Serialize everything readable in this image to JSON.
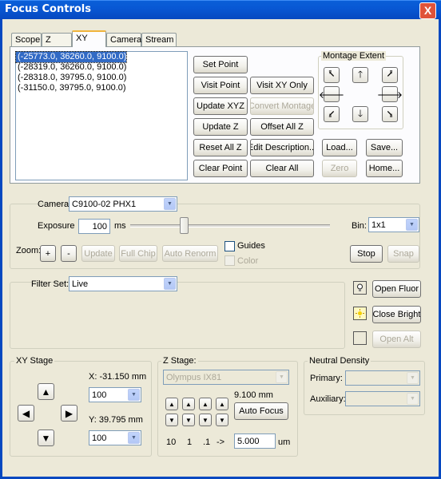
{
  "window": {
    "title": "Focus Controls",
    "close_glyph": "X"
  },
  "tabs": [
    {
      "label": "Scope",
      "active": false
    },
    {
      "label": "Z",
      "active": false
    },
    {
      "label": "XY",
      "active": true
    },
    {
      "label": "Camera",
      "active": false
    },
    {
      "label": "Stream",
      "active": false
    }
  ],
  "xy_list": {
    "items": [
      "(-25773.0, 36260.0, 9100.0)",
      "(-28319.0, 36260.0, 9100.0)",
      "(-28318.0, 39795.0, 9100.0)",
      "(-31150.0, 39795.0, 9100.0)"
    ],
    "selected_index": 0
  },
  "xy_buttons": {
    "set_point": "Set Point",
    "visit_point": "Visit Point",
    "visit_xy_only": "Visit XY Only",
    "update_xyz": "Update XYZ",
    "convert_montage": "Convert Montage",
    "update_z": "Update Z",
    "offset_all_z": "Offset All Z",
    "reset_all_z": "Reset All Z",
    "edit_description": "Edit Description...",
    "clear_point": "Clear Point",
    "clear_all": "Clear All"
  },
  "montage": {
    "title": "Montage Extent",
    "arrows": {
      "nw": "⭶",
      "n": "🡑",
      "ne": "⭷",
      "w": "🡐",
      "e": "🡒",
      "sw": "⭹",
      "s": "🡓",
      "se": "⭸"
    },
    "load": "Load...",
    "save": "Save...",
    "zero": "Zero",
    "home": "Home..."
  },
  "camera": {
    "camera_label": "Camera:",
    "camera_value": "C9100-02 PHX1",
    "exposure_label": "Exposure",
    "exposure_value": "100",
    "exposure_unit": "ms",
    "exposure_slider_fraction": 0.26,
    "bin_label": "Bin:",
    "bin_value": "1x1",
    "zoom_label": "Zoom:",
    "zoom_plus": "+",
    "zoom_minus": "-",
    "update": "Update",
    "full_chip": "Full Chip",
    "auto_renorm": "Auto Renorm",
    "guides_label": "Guides",
    "color_label": "Color",
    "stop": "Stop",
    "snap": "Snap"
  },
  "filter": {
    "filter_set_label": "Filter Set:",
    "filter_set_value": "Live",
    "open_fluor": "Open Fluor",
    "close_bright": "Close Bright",
    "open_alt": "Open Alt"
  },
  "xy_stage": {
    "title": "XY Stage",
    "x_label": "X: -31.150 mm",
    "x_step": "100",
    "y_label": "Y: 39.795 mm",
    "y_step": "100",
    "arrows": {
      "up": "▲",
      "down": "▼",
      "left": "◀",
      "right": "▶"
    }
  },
  "z_stage": {
    "title": "Z Stage:",
    "device": "Olympus IX81",
    "position": "9.100 mm",
    "auto_focus": "Auto Focus",
    "up_glyph": "▲",
    "down_glyph": "▼",
    "step_labels": [
      "10",
      "1",
      ".1",
      "->"
    ],
    "step_value": "5.000",
    "step_unit": "um"
  },
  "neutral_density": {
    "title": "Neutral Density",
    "primary_label": "Primary:",
    "auxiliary_label": "Auxiliary:"
  }
}
